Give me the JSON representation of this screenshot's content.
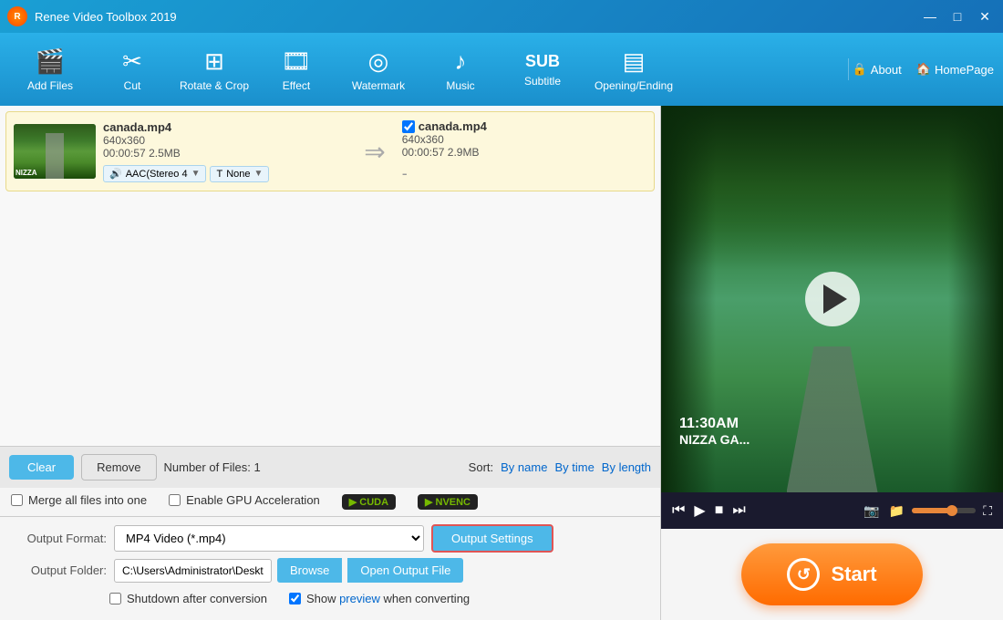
{
  "titleBar": {
    "title": "Renee Video Toolbox 2019",
    "controls": {
      "minimize": "—",
      "maximize": "□",
      "close": "✕"
    }
  },
  "toolbar": {
    "items": [
      {
        "id": "add-files",
        "icon": "🎬",
        "label": "Add Files"
      },
      {
        "id": "cut",
        "icon": "✂",
        "label": "Cut"
      },
      {
        "id": "rotate-crop",
        "icon": "⟳",
        "label": "Rotate & Crop"
      },
      {
        "id": "effect",
        "icon": "✦",
        "label": "Effect"
      },
      {
        "id": "watermark",
        "icon": "◎",
        "label": "Watermark"
      },
      {
        "id": "music",
        "icon": "♪",
        "label": "Music"
      },
      {
        "id": "subtitle",
        "icon": "SUB",
        "label": "Subtitle"
      },
      {
        "id": "opening-ending",
        "icon": "▤",
        "label": "Opening/Ending"
      }
    ],
    "right": {
      "about_label": "About",
      "homepage_label": "HomePage"
    }
  },
  "fileList": {
    "items": [
      {
        "input": {
          "name": "canada.mp4",
          "resolution": "640x360",
          "duration": "00:00:57",
          "size": "2.5MB",
          "audio": "AAC(Stereo 4",
          "subtitle": "None"
        },
        "output": {
          "name": "canada.mp4",
          "resolution": "640x360",
          "duration": "00:00:57",
          "size": "2.9MB"
        }
      }
    ]
  },
  "bottomControls": {
    "clear_label": "Clear",
    "remove_label": "Remove",
    "file_count_label": "Number of Files:",
    "file_count": "1",
    "sort_label": "Sort:",
    "sort_by_name": "By name",
    "sort_by_time": "By time",
    "sort_by_length": "By length"
  },
  "checkboxes": {
    "merge_label": "Merge all files into one",
    "gpu_label": "Enable GPU Acceleration",
    "shutdown_label": "Shutdown after conversion",
    "preview_label": "Show preview when converting"
  },
  "gpuBadges": {
    "cuda": "CUDA",
    "nvenc": "NVENC"
  },
  "outputFormat": {
    "label": "Output Format:",
    "value": "MP4 Video (*.mp4)",
    "button_label": "Output Settings"
  },
  "outputFolder": {
    "label": "Output Folder:",
    "value": "C:\\Users\\Administrator\\Desktop\\download\\",
    "browse_label": "Browse",
    "open_label": "Open Output File"
  },
  "videoPreview": {
    "time": "11:30AM",
    "location": "NIZZA GA...",
    "play_title": "Play"
  },
  "videoControls": {
    "skip_back": "⏮",
    "play": "▶",
    "stop": "■",
    "skip_forward": "⏭",
    "camera": "📷",
    "folder": "📁",
    "volume": "🔊",
    "fullscreen": "⛶"
  },
  "startButton": {
    "label": "Start"
  }
}
